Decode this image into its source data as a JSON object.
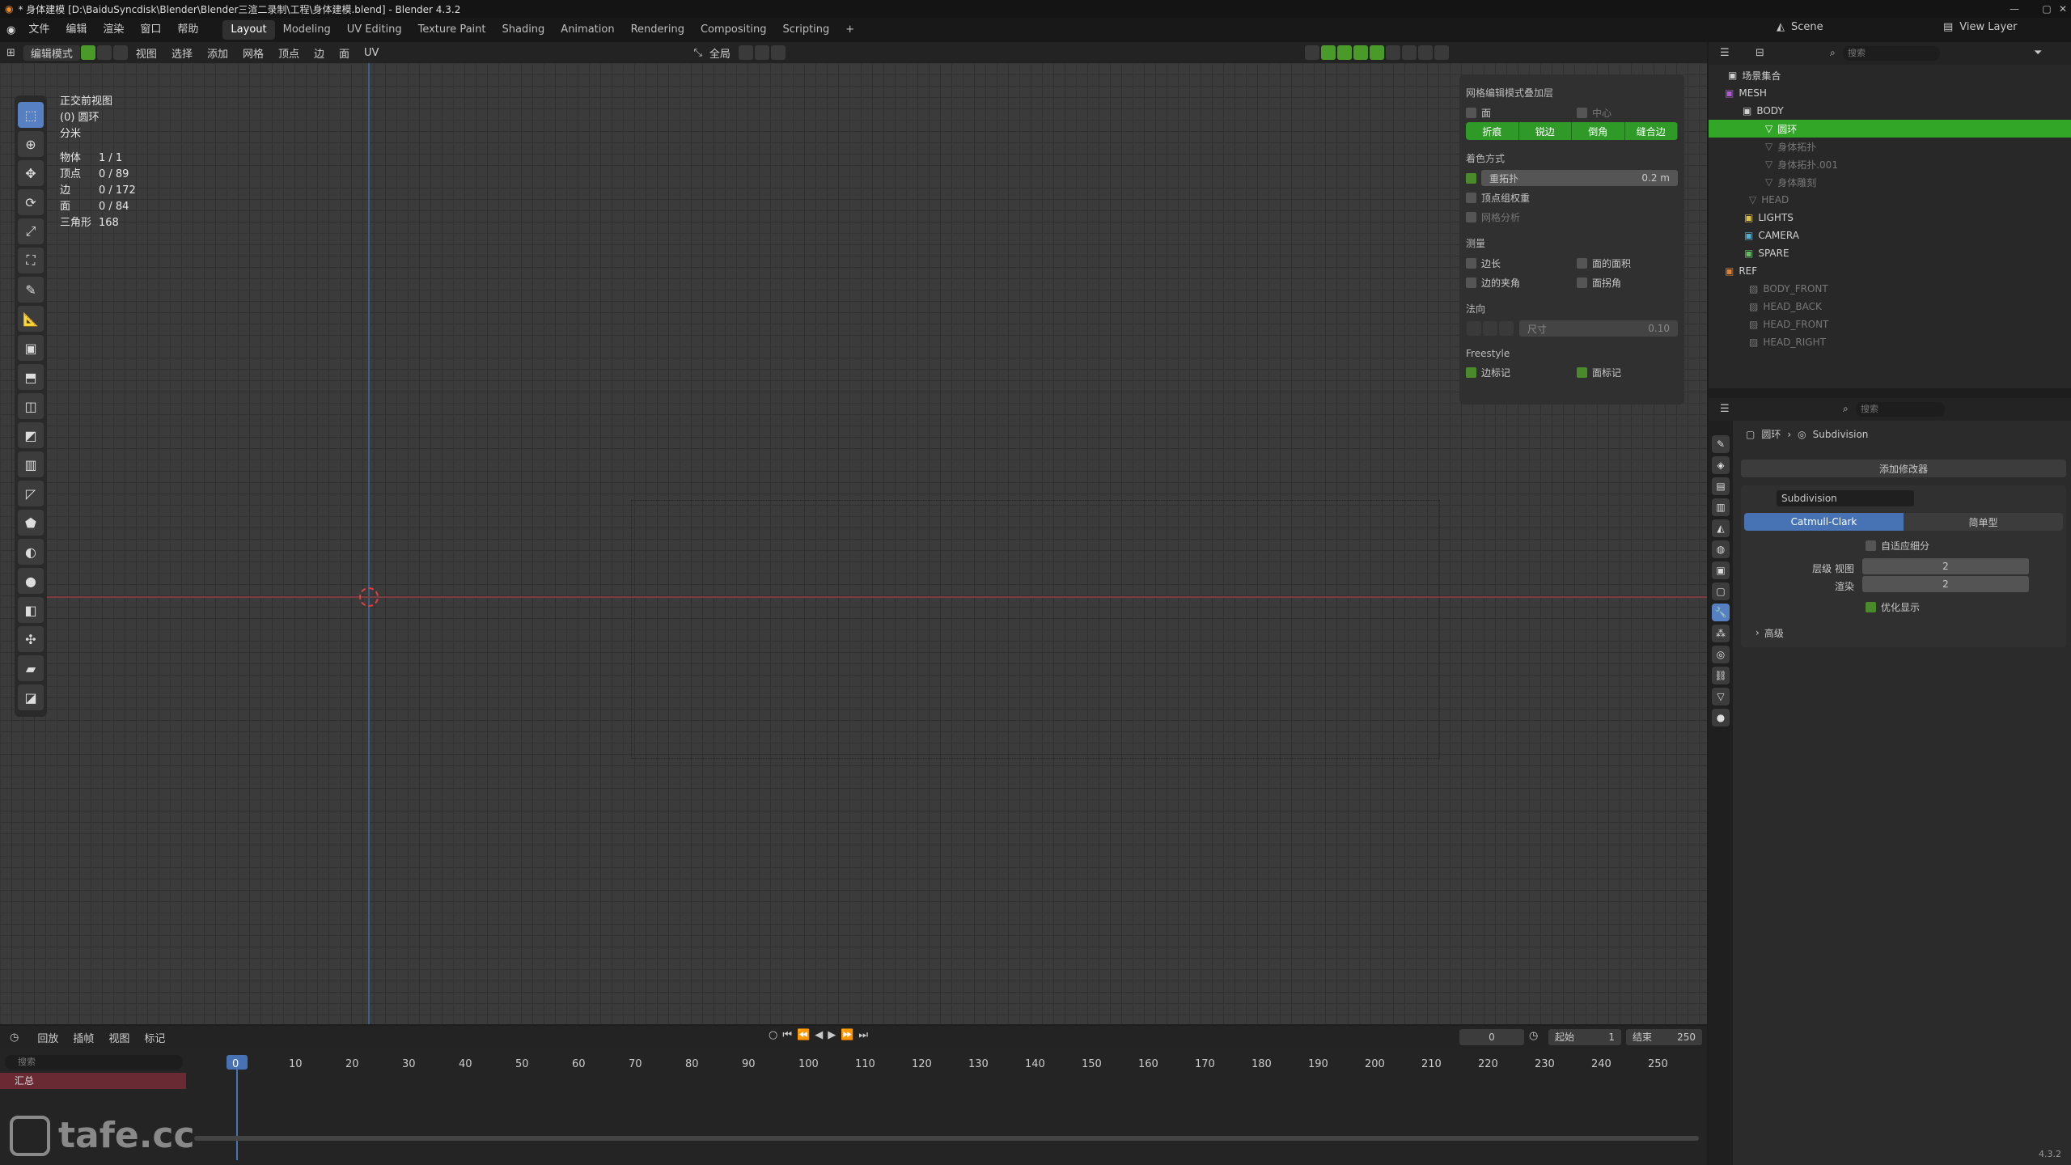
{
  "titlebar": {
    "title": "* 身体建模 [D:\\BaiduSyncdisk\\Blender\\Blender三渲二录制\\工程\\身体建模.blend] - Blender 4.3.2"
  },
  "menu": {
    "items": [
      "文件",
      "编辑",
      "渲染",
      "窗口",
      "帮助"
    ]
  },
  "workspaces": [
    "Layout",
    "Modeling",
    "UV Editing",
    "Texture Paint",
    "Shading",
    "Animation",
    "Rendering",
    "Compositing",
    "Scripting",
    "+"
  ],
  "scene": {
    "scene_label": "Scene",
    "view_layer_label": "View Layer"
  },
  "viewport_header": {
    "mode": "编辑模式",
    "menus": [
      "视图",
      "选择",
      "添加",
      "网格",
      "顶点",
      "边",
      "面",
      "UV"
    ],
    "transform": "全局"
  },
  "viewport_info": {
    "view_name": "正交前视图",
    "object": "(0) 圆环",
    "unit": "分米",
    "stats": [
      {
        "label": "物体",
        "value": "1 / 1"
      },
      {
        "label": "顶点",
        "value": "0 / 89"
      },
      {
        "label": "边",
        "value": "0 / 172"
      },
      {
        "label": "面",
        "value": "0 / 84"
      },
      {
        "label": "三角形",
        "value": "168"
      }
    ]
  },
  "overlay_panel": {
    "title": "网格编辑模式叠加层",
    "row1_a": "面",
    "row1_b": "中心",
    "seg_buttons": [
      "折痕",
      "锐边",
      "倒角",
      "缝合边"
    ],
    "shading_title": "着色方式",
    "retopo": "重拓扑",
    "retopo_value": "0.2 m",
    "vertex_group": "顶点组权重",
    "mesh_analysis": "网格分析",
    "measure_title": "测量",
    "m1": "边长",
    "m2": "面的面积",
    "m3": "边的夹角",
    "m4": "面拐角",
    "normals_title": "法向",
    "size_label": "尺寸",
    "size_value": "0.10",
    "freestyle_title": "Freestyle",
    "fs1": "边标记",
    "fs2": "面标记"
  },
  "outliner": {
    "search_placeholder": "搜索",
    "rows": [
      "场景集合",
      "MESH",
      "BODY",
      "圆环",
      "身体拓扑",
      "身体拓扑.001",
      "身体雕刻",
      "HEAD",
      "LIGHTS",
      "CAMERA",
      "SPARE",
      "REF",
      "BODY_FRONT",
      "HEAD_BACK",
      "HEAD_FRONT",
      "HEAD_RIGHT"
    ]
  },
  "properties": {
    "search_placeholder": "搜索",
    "breadcrumb_obj": "圆环",
    "breadcrumb_mod": "Subdivision",
    "add_modifier": "添加修改器",
    "modifier_name": "Subdivision",
    "type_a": "Catmull-Clark",
    "type_b": "简单型",
    "adaptive": "自适应细分",
    "levels_view_label": "层级 视图",
    "levels_view": "2",
    "render_label": "渲染",
    "render_value": "2",
    "optimal": "优化显示",
    "advanced": "高级"
  },
  "timeline": {
    "menus": [
      "回放",
      "插帧",
      "视图",
      "标记"
    ],
    "current_frame": "0",
    "start_label": "起始",
    "start": "1",
    "end_label": "结束",
    "end": "250",
    "ticks": [
      "0",
      "10",
      "20",
      "30",
      "40",
      "50",
      "60",
      "70",
      "80",
      "90",
      "100",
      "110",
      "120",
      "130",
      "140",
      "150",
      "160",
      "170",
      "180",
      "190",
      "200",
      "210",
      "220",
      "230",
      "240",
      "250"
    ],
    "summary": "汇总",
    "search_placeholder": "搜索"
  },
  "watermark": "tafe.cc",
  "version": "4.3.2"
}
